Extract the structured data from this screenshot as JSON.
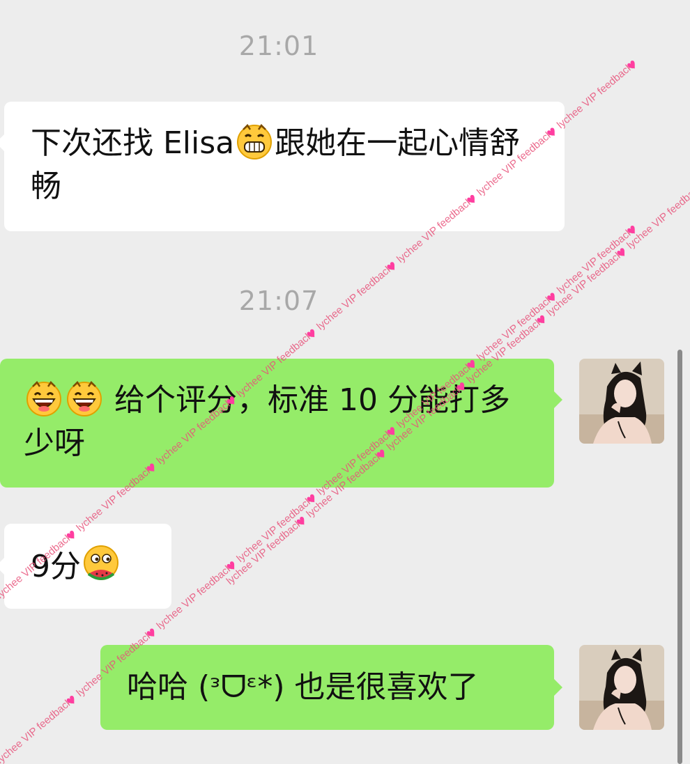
{
  "messages": [
    {
      "type": "timestamp",
      "text": "21:01"
    },
    {
      "type": "received",
      "text_before": "下次还找 Elisa",
      "emoji": "grin-emoji",
      "text_after": "跟她在一起心情舒畅"
    },
    {
      "type": "timestamp",
      "text": "21:07"
    },
    {
      "type": "sent",
      "emojis": [
        "grinning-emoji",
        "grinning-emoji"
      ],
      "text": " 给个评分，标准 10 分能打多少呀"
    },
    {
      "type": "received",
      "text": "9分",
      "emoji": "eating-watermelon-emoji"
    },
    {
      "type": "sent",
      "text": "哈哈 (ᵌᗜᵋ*) 也是很喜欢了"
    }
  ],
  "watermark": {
    "text": "lychee VIP feedback",
    "color": "#e8527a"
  },
  "colors": {
    "background": "#ededed",
    "received_bubble": "#ffffff",
    "sent_bubble": "#95ec69",
    "timestamp": "#a8a8a8"
  }
}
